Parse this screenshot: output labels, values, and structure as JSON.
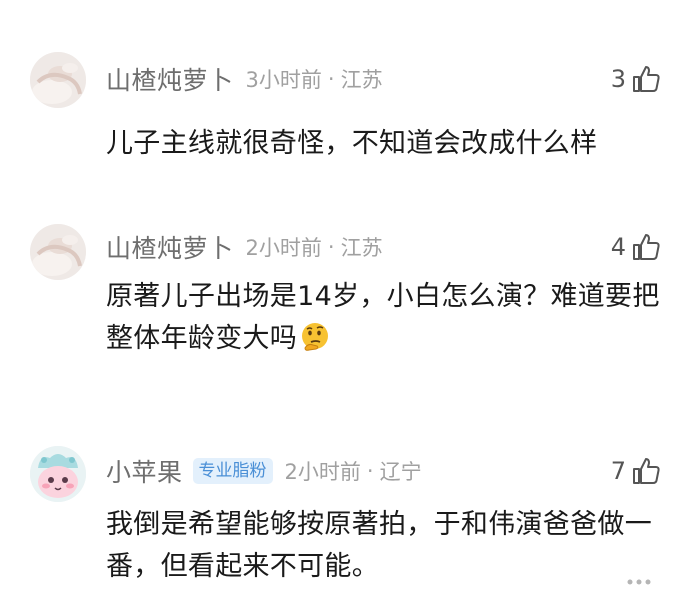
{
  "comments": [
    {
      "nickname": "山楂炖萝卜",
      "badge": "",
      "time": "3小时前",
      "location": "江苏",
      "likes": "3",
      "text": "儿子主线就很奇怪，不知道会改成什么样"
    },
    {
      "nickname": "山楂炖萝卜",
      "badge": "",
      "time": "2小时前",
      "location": "江苏",
      "likes": "4",
      "text": "原著儿子出场是14岁，小白怎么演？难道要把整体年龄变大吗",
      "emoji": "thinking-face-emoji"
    },
    {
      "nickname": "小苹果",
      "badge": "专业脂粉",
      "time": "2小时前",
      "location": "辽宁",
      "likes": "7",
      "text": "我倒是希望能够按原著拍，于和伟演爸爸做一番，但看起来不可能。"
    }
  ],
  "separator": "·",
  "colors": {
    "nickname": "#6e6e6e",
    "meta": "#a0a0a0",
    "text": "#1a1a1a",
    "badge_text": "#4a8fd6",
    "badge_bg": "#e3f0fc"
  }
}
